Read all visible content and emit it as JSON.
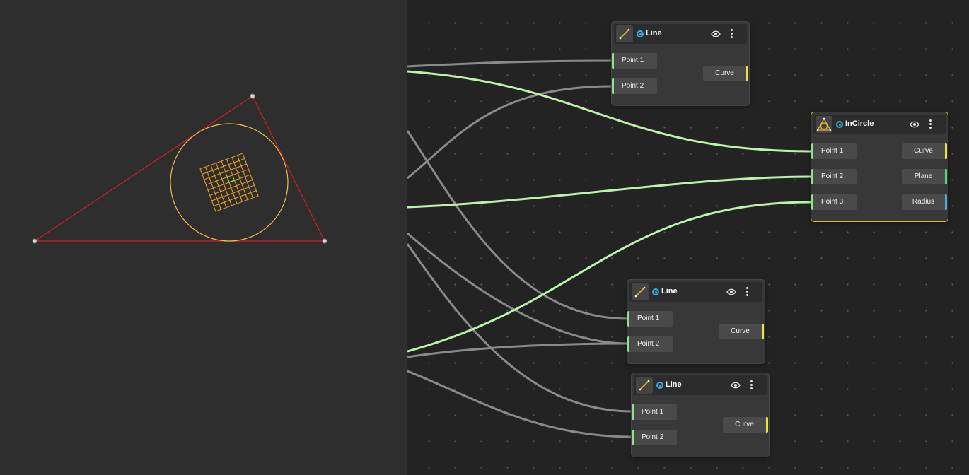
{
  "viewport": {
    "label": "3D viewport",
    "colors": {
      "triangle": "#d0202a",
      "incircle": "#f0c040",
      "plane_grid": "#f0a020",
      "point": "#d8d8d8"
    }
  },
  "nodes": {
    "line_a": {
      "title": "Line",
      "icon": "line-icon",
      "inputs": [
        "Point 1",
        "Point 2"
      ],
      "outputs": [
        "Curve"
      ]
    },
    "incircle": {
      "title": "InCircle",
      "icon": "incircle-icon",
      "inputs": [
        "Point 1",
        "Point 2",
        "Point 3"
      ],
      "outputs": [
        "Curve",
        "Plane",
        "Radius"
      ],
      "selected": true
    },
    "line_b": {
      "title": "Line",
      "icon": "line-icon",
      "inputs": [
        "Point 1",
        "Point 2"
      ],
      "outputs": [
        "Curve"
      ]
    },
    "line_c": {
      "title": "Line",
      "icon": "line-icon",
      "inputs": [
        "Point 1",
        "Point 2"
      ],
      "outputs": [
        "Curve"
      ]
    }
  },
  "colors": {
    "active_wire": "#b8f5a8",
    "inactive_wire": "#8a8a8a",
    "input_port": "#8ee38a",
    "curve_output": "#f0e040",
    "plane_output": "#4fd98a",
    "radius_output": "#4fa8d9",
    "selection": "#e0b93c",
    "visibility_toggle": "#3aaee0"
  }
}
